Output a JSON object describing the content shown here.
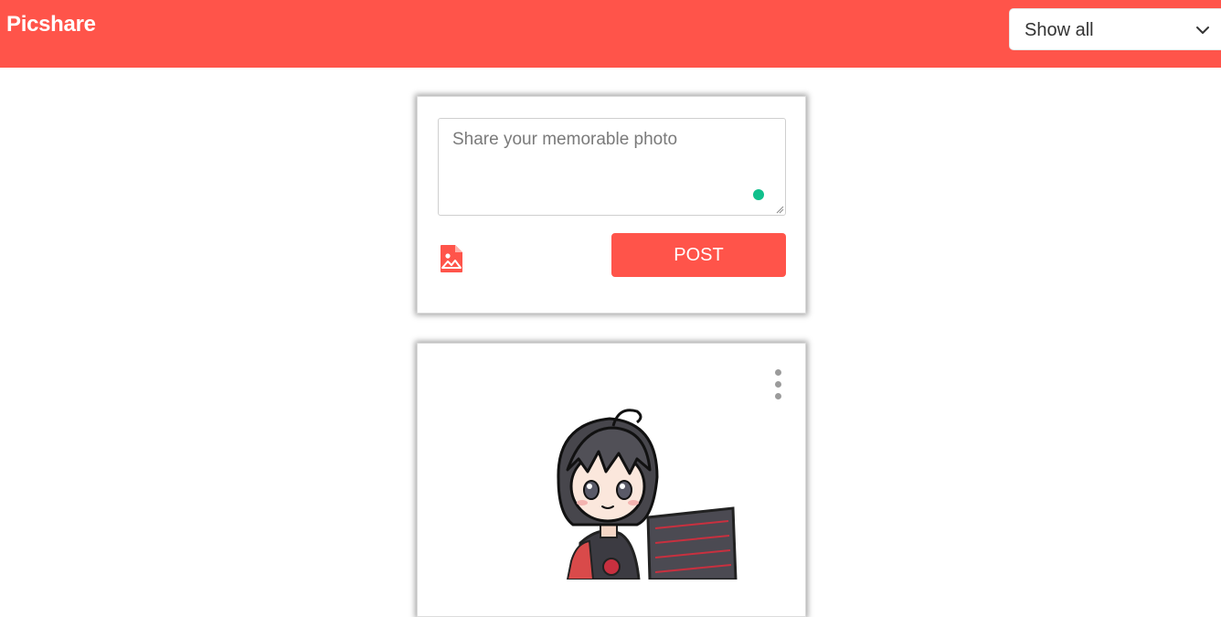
{
  "navbar": {
    "brand": "Picshare",
    "filter": {
      "selected": "Show all",
      "icon": "chevron-down-icon"
    },
    "background": "#ff544a"
  },
  "composer": {
    "placeholder": "Share your memorable photo",
    "value": "",
    "image_upload_icon": "image-file-icon",
    "post_label": "POST",
    "status_dot_color": "#10c08c"
  },
  "feed": {
    "posts": [
      {
        "menu_icon": "kebab-menu-icon",
        "image": "chibi-character-illustration"
      }
    ]
  }
}
